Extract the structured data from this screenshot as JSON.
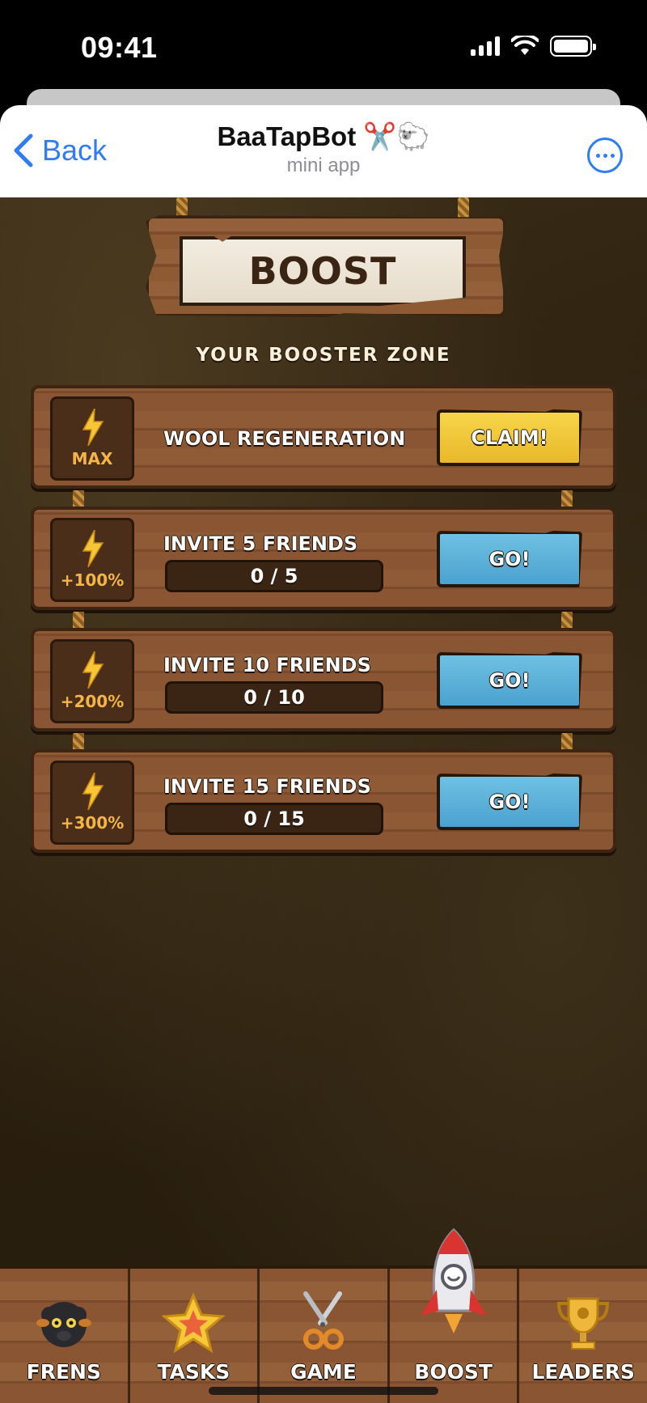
{
  "status_bar": {
    "time": "09:41"
  },
  "header": {
    "back_label": "Back",
    "title": "BaaTapBot ✂️🐑",
    "subtitle": "mini app"
  },
  "sign": {
    "title": "BOOST"
  },
  "zone_title": "YOUR BOOSTER ZONE",
  "boosters": [
    {
      "badge": "MAX",
      "title": "WOOL REGENERATION",
      "progress": null,
      "action": "CLAIM!",
      "style": "claim"
    },
    {
      "badge": "+100%",
      "title": "INVITE 5 FRIENDS",
      "progress": "0 / 5",
      "action": "GO!",
      "style": "go"
    },
    {
      "badge": "+200%",
      "title": "INVITE 10 FRIENDS",
      "progress": "0 / 10",
      "action": "GO!",
      "style": "go"
    },
    {
      "badge": "+300%",
      "title": "INVITE 15 FRIENDS",
      "progress": "0 / 15",
      "action": "GO!",
      "style": "go"
    }
  ],
  "nav": [
    {
      "label": "FRENS",
      "icon": "sheep-icon"
    },
    {
      "label": "TASKS",
      "icon": "star-icon"
    },
    {
      "label": "GAME",
      "icon": "scissors-icon"
    },
    {
      "label": "BOOST",
      "icon": "rocket-icon",
      "active": true
    },
    {
      "label": "LEADERS",
      "icon": "trophy-icon"
    }
  ],
  "colors": {
    "ios_blue": "#2f7cf6",
    "claim_yellow": "#f3c93a",
    "go_blue": "#5fb3dc",
    "badge_orange": "#f3b547",
    "wood": "#8a5532"
  }
}
